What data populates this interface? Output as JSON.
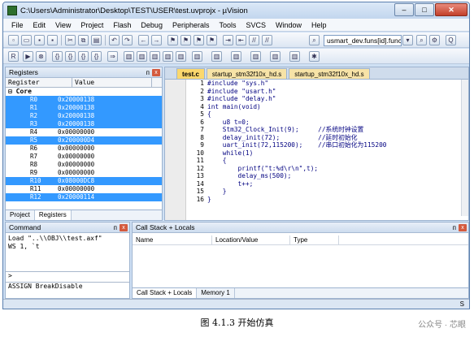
{
  "window": {
    "title": "C:\\Users\\Administrator\\Desktop\\TEST\\USER\\test.uvprojx - µVision",
    "minimize": "–",
    "maximize": "□",
    "close": "✕"
  },
  "menu": [
    "File",
    "Edit",
    "View",
    "Project",
    "Flash",
    "Debug",
    "Peripherals",
    "Tools",
    "SVCS",
    "Window",
    "Help"
  ],
  "toolbar": {
    "function_combo": "usmart_dev.funs[id].func"
  },
  "registers": {
    "title": "Registers",
    "col_register": "Register",
    "col_value": "Value",
    "group": "Core",
    "rows": [
      {
        "n": "R0",
        "v": "0x20000138",
        "sel": true
      },
      {
        "n": "R1",
        "v": "0x20000138",
        "sel": true
      },
      {
        "n": "R2",
        "v": "0x20000138",
        "sel": true
      },
      {
        "n": "R3",
        "v": "0x20000138",
        "sel": true
      },
      {
        "n": "R4",
        "v": "0x00000000",
        "sel": false
      },
      {
        "n": "R5",
        "v": "0x200000D4",
        "sel": true
      },
      {
        "n": "R6",
        "v": "0x00000000",
        "sel": false
      },
      {
        "n": "R7",
        "v": "0x00000000",
        "sel": false
      },
      {
        "n": "R8",
        "v": "0x00000000",
        "sel": false
      },
      {
        "n": "R9",
        "v": "0x00000000",
        "sel": false
      },
      {
        "n": "R10",
        "v": "0x08000DC8",
        "sel": true
      },
      {
        "n": "R11",
        "v": "0x00000000",
        "sel": false
      },
      {
        "n": "R12",
        "v": "0x20000114",
        "sel": true
      }
    ],
    "tab_project": "Project",
    "tab_registers": "Registers"
  },
  "editor": {
    "tabs": [
      "test.c",
      "startup_stm32f10x_hd.s",
      "startup_stm32f10x_hd.s"
    ],
    "lines": [
      "1",
      "2",
      "3",
      "4",
      "5",
      "6",
      "7",
      "8",
      "9",
      "10",
      "11",
      "12",
      "13",
      "14",
      "15",
      "16"
    ],
    "code": [
      "#include \"sys.h\"",
      "#include \"usart.h\"",
      "#include \"delay.h\"",
      "int main(void)",
      "{",
      "    u8 t=0;",
      "    Stm32_Clock_Init(9);     //系统时钟设置",
      "    delay_init(72);          //延时初始化",
      "    uart_init(72,115200);    //串口初始化为115200",
      "    while(1)",
      "    {",
      "        printf(\"t:%d\\r\\n\",t);",
      "        delay_ms(500);",
      "        t++;",
      "    }",
      "}"
    ]
  },
  "command": {
    "title": "Command",
    "out1": "Load \"..\\\\OBJ\\\\test.axf\"",
    "out2": "WS 1, `t",
    "prompt": ">",
    "hint": "ASSIGN BreakDisable"
  },
  "callstack": {
    "title": "Call Stack + Locals",
    "col_name": "Name",
    "col_loc": "Location/Value",
    "col_type": "Type",
    "tab1": "Call Stack + Locals",
    "tab2": "Memory 1"
  },
  "status": {
    "right": "S"
  },
  "caption": "图 4.1.3  开始仿真",
  "watermark": "公众号 · 芯眼"
}
